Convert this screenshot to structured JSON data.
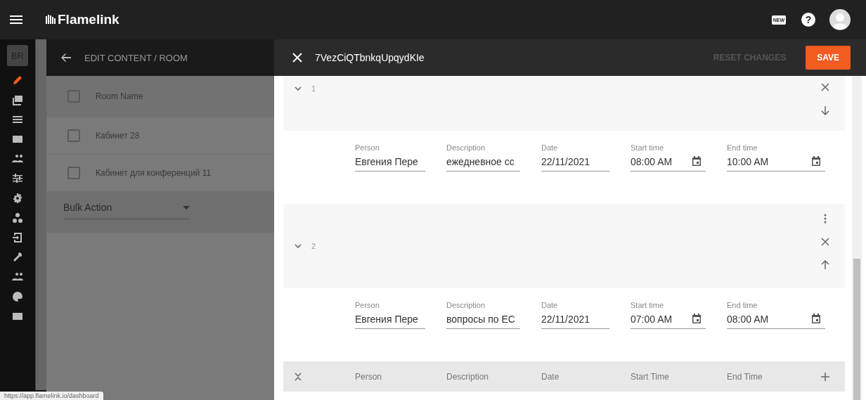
{
  "app_bar": {
    "brand": "Flamelink",
    "new_badge": "NEW",
    "help": "?"
  },
  "sidebar": {
    "avatar": "BR",
    "items": [
      {
        "kind": "pencil",
        "selected": true
      },
      {
        "kind": "images",
        "selected": false
      },
      {
        "kind": "lines",
        "selected": false
      },
      {
        "kind": "card",
        "selected": false
      },
      {
        "kind": "people",
        "selected": false
      },
      {
        "kind": "sliders",
        "selected": false
      },
      {
        "kind": "gear",
        "selected": false
      },
      {
        "kind": "nodes",
        "selected": false
      },
      {
        "kind": "login",
        "selected": false
      },
      {
        "kind": "wrench",
        "selected": false
      },
      {
        "kind": "people",
        "selected": false
      },
      {
        "kind": "palette",
        "selected": false
      },
      {
        "kind": "card",
        "selected": false
      }
    ]
  },
  "content_panel": {
    "title": "EDIT CONTENT / ROOM",
    "rows": [
      {
        "label": "Room Name",
        "kind": "header",
        "checked": false
      },
      {
        "label": "Кабинет 28",
        "kind": "row",
        "checked": false
      },
      {
        "label": "Кабинет для конференций 11",
        "kind": "row",
        "checked": false
      }
    ],
    "bulk_action": "Bulk Action"
  },
  "drawer": {
    "title": "7VezCiQTbnkqUpqydKIe",
    "reset_button": "RESET CHANGES",
    "save_button": "SAVE",
    "entries": [
      {
        "index": "1",
        "expanded": true,
        "actions": [
          {
            "kind": "close"
          },
          {
            "kind": "down"
          }
        ],
        "fields": [
          {
            "label": "Person",
            "value": "Евгения Пере",
            "kind": "text"
          },
          {
            "label": "Description",
            "value": "ежедневное сс",
            "kind": "text"
          },
          {
            "label": "Date",
            "value": "22/11/2021",
            "kind": "text"
          },
          {
            "label": "Start time",
            "value": "08:00 AM",
            "kind": "time"
          },
          {
            "label": "End time",
            "value": "10:00 AM",
            "kind": "time"
          }
        ]
      },
      {
        "index": "2",
        "expanded": true,
        "actions": [
          {
            "kind": "more"
          },
          {
            "kind": "close"
          },
          {
            "kind": "up"
          }
        ],
        "fields": [
          {
            "label": "Person",
            "value": "Евгения Пере",
            "kind": "text"
          },
          {
            "label": "Description",
            "value": "вопросы по ЕС",
            "kind": "text"
          },
          {
            "label": "Date",
            "value": "22/11/2021",
            "kind": "text"
          },
          {
            "label": "Start time",
            "value": "07:00 AM",
            "kind": "time"
          },
          {
            "label": "End time",
            "value": "08:00 AM",
            "kind": "time"
          }
        ]
      }
    ],
    "columns": [
      "Person",
      "Description",
      "Date",
      "Start Time",
      "End Time"
    ]
  },
  "status_url": "https://app.flamelink.io/dashboard"
}
